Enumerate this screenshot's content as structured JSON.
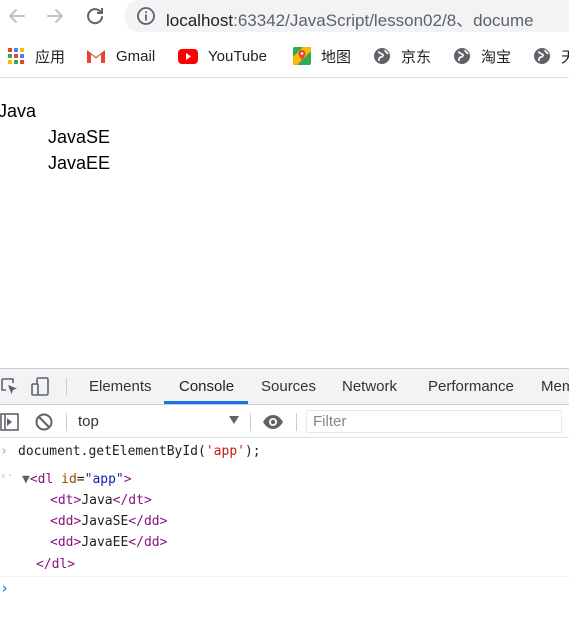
{
  "browser": {
    "url_host": "localhost",
    "url_path": ":63342/JavaScript/lesson02/8、docume",
    "bookmarks": [
      {
        "label": "应用",
        "icon": "apps-grid-icon"
      },
      {
        "label": "Gmail",
        "icon": "gmail-icon"
      },
      {
        "label": "YouTube",
        "icon": "youtube-icon"
      },
      {
        "label": "地图",
        "icon": "maps-icon"
      },
      {
        "label": "京东",
        "icon": "globe-icon"
      },
      {
        "label": "淘宝",
        "icon": "globe-icon"
      },
      {
        "label": "天",
        "icon": "globe-icon"
      }
    ]
  },
  "page": {
    "dt": "Java",
    "dd": [
      "JavaSE",
      "JavaEE"
    ]
  },
  "devtools": {
    "tabs": [
      "Elements",
      "Console",
      "Sources",
      "Network",
      "Performance",
      "Mem"
    ],
    "active_tab": "Console",
    "context": "top",
    "filter_placeholder": "Filter",
    "console": {
      "command_prefix": "document.getElementById(",
      "command_arg": "'app'",
      "command_suffix": ");",
      "result": {
        "open_tag_name": "dl",
        "attr_name": "id",
        "attr_value": "\"app\"",
        "children": [
          {
            "tag": "dt",
            "text": "Java"
          },
          {
            "tag": "dd",
            "text": "JavaSE"
          },
          {
            "tag": "dd",
            "text": "JavaEE"
          }
        ],
        "close_tag": "</dl>"
      }
    }
  },
  "colors": {
    "accent": "#1a73e8",
    "tag": "#881280",
    "attr_name": "#994500",
    "attr_value": "#1a1aa6",
    "string": "#c41a16"
  }
}
